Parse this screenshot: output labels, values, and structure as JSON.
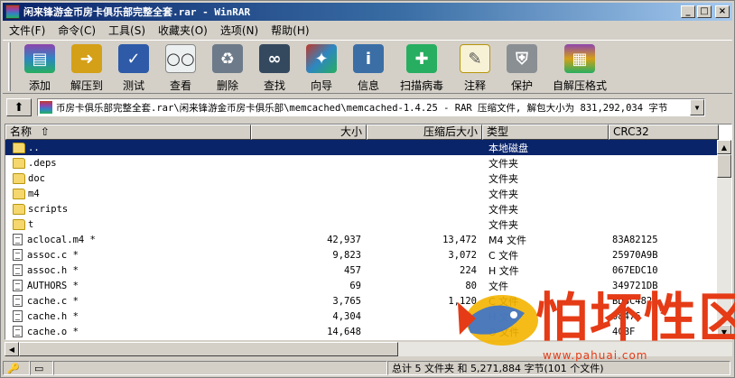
{
  "window": {
    "title": "闲来锋游金币房卡俱乐部完整全套.rar - WinRAR",
    "controls": {
      "minimize": "_",
      "maximize": "□",
      "close": "×"
    }
  },
  "menu": [
    "文件(F)",
    "命令(C)",
    "工具(S)",
    "收藏夹(O)",
    "选项(N)",
    "帮助(H)"
  ],
  "toolbar": [
    {
      "label": "添加",
      "icon": "add-books-icon",
      "color": "#8e44ad"
    },
    {
      "label": "解压到",
      "icon": "extract-folder-icon",
      "color": "#d4a017"
    },
    {
      "label": "测试",
      "icon": "test-clipboard-icon",
      "color": "#2e5aa8"
    },
    {
      "label": "查看",
      "icon": "view-glasses-icon",
      "color": "#7f8c8d"
    },
    {
      "label": "删除",
      "icon": "delete-recycle-icon",
      "color": "#6c7a89"
    },
    {
      "label": "查找",
      "icon": "find-binoculars-icon",
      "color": "#34495e"
    },
    {
      "label": "向导",
      "icon": "wizard-icon",
      "color": "#c0392b"
    },
    {
      "label": "信息",
      "icon": "info-icon",
      "color": "#3b6ea5"
    },
    {
      "label": "扫描病毒",
      "icon": "virus-scan-icon",
      "color": "#27ae60"
    },
    {
      "label": "注释",
      "icon": "comment-icon",
      "color": "#b7950b"
    },
    {
      "label": "保护",
      "icon": "protect-shield-icon",
      "color": "#8a8f94"
    },
    {
      "label": "自解压格式",
      "icon": "sfx-icon",
      "color": "#a04000"
    }
  ],
  "address": {
    "path": "币房卡俱乐部完整全套.rar\\闲来锋游金币房卡俱乐部\\memcached\\memcached-1.4.25 - RAR 压缩文件, 解包大小为 831,292,034 字节"
  },
  "columns": {
    "name": "名称",
    "size": "大小",
    "packed": "压缩后大小",
    "type": "类型",
    "crc": "CRC32"
  },
  "files": [
    {
      "name": "..",
      "size": "",
      "packed": "",
      "type": "本地磁盘",
      "crc": "",
      "kind": "folder",
      "selected": true
    },
    {
      "name": ".deps",
      "size": "",
      "packed": "",
      "type": "文件夹",
      "crc": "",
      "kind": "folder"
    },
    {
      "name": "doc",
      "size": "",
      "packed": "",
      "type": "文件夹",
      "crc": "",
      "kind": "folder"
    },
    {
      "name": "m4",
      "size": "",
      "packed": "",
      "type": "文件夹",
      "crc": "",
      "kind": "folder"
    },
    {
      "name": "scripts",
      "size": "",
      "packed": "",
      "type": "文件夹",
      "crc": "",
      "kind": "folder"
    },
    {
      "name": "t",
      "size": "",
      "packed": "",
      "type": "文件夹",
      "crc": "",
      "kind": "folder"
    },
    {
      "name": "aclocal.m4 *",
      "size": "42,937",
      "packed": "13,472",
      "type": "M4 文件",
      "crc": "83A82125",
      "kind": "file"
    },
    {
      "name": "assoc.c *",
      "size": "9,823",
      "packed": "3,072",
      "type": "C 文件",
      "crc": "25970A9B",
      "kind": "file"
    },
    {
      "name": "assoc.h *",
      "size": "457",
      "packed": "224",
      "type": "H 文件",
      "crc": "067EDC10",
      "kind": "file"
    },
    {
      "name": "AUTHORS *",
      "size": "69",
      "packed": "80",
      "type": "文件",
      "crc": "349721DB",
      "kind": "file"
    },
    {
      "name": "cache.c *",
      "size": "3,765",
      "packed": "1,120",
      "type": "C 文件",
      "crc": "BDBC482A",
      "kind": "file"
    },
    {
      "name": "cache.h *",
      "size": "4,304",
      "packed": "1,",
      "type": "H 文件",
      "crc": "08476",
      "kind": "file"
    },
    {
      "name": "cache.o *",
      "size": "14,648",
      "packed": "",
      "type": "O 文件",
      "crc": "4CBF",
      "kind": "file"
    }
  ],
  "status": {
    "left_icons": "key-drive-icons",
    "summary": "总计 5 文件夹 和 5,271,884 字节(101 个文件)"
  },
  "watermark": {
    "text": "怕坏性区",
    "url": "www.pahuai.com"
  }
}
